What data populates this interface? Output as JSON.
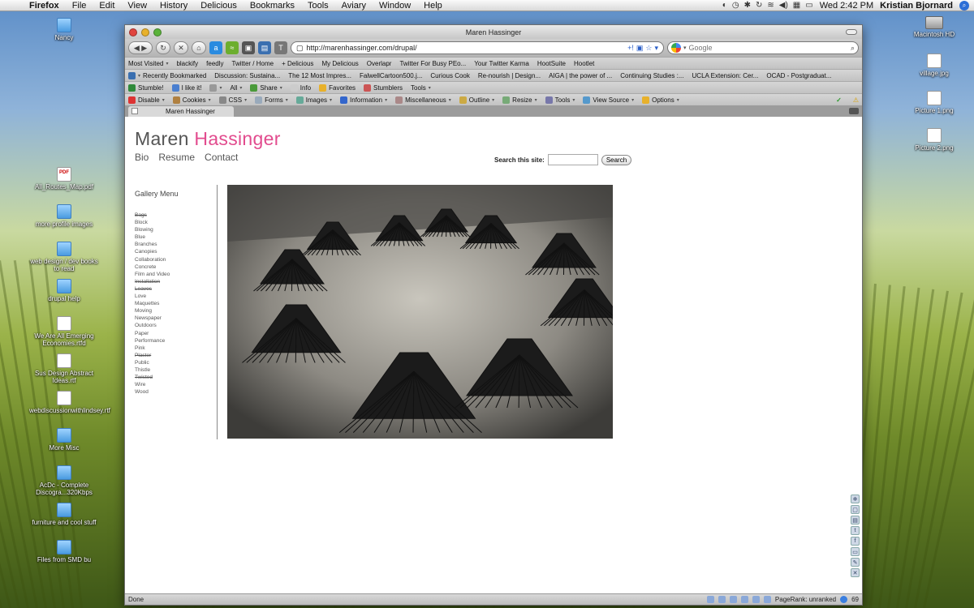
{
  "menubar": {
    "app": "Firefox",
    "items": [
      "File",
      "Edit",
      "View",
      "History",
      "Delicious",
      "Bookmarks",
      "Tools",
      "Aviary",
      "Window",
      "Help"
    ],
    "clock": "Wed 2:42 PM",
    "user": "Kristian Bjornard"
  },
  "desktop": {
    "icons": [
      "Nancy",
      "All_Routes_Map.pdf",
      "more profile images",
      "web design / dev books to read",
      "drupal help",
      "We Are All Emerging Economies.rtfd",
      "Sus Design Abstract Ideas.rtf",
      "webdiscussionwithlindsey.rtf",
      "More Misc",
      "AcDc - Complete Discogra...320Kbps",
      "furniture and cool stuff",
      "Files from SMD bu"
    ],
    "right_icons": [
      "Macintosh HD",
      "village.jpg",
      "Picture 1.png",
      "Picture 2.png"
    ]
  },
  "browser": {
    "window_title": "Maren Hassinger",
    "url": "http://marenhassinger.com/drupal/",
    "search_placeholder": "Google",
    "bookmarks": [
      "Most Visited",
      "blackify",
      "feedly",
      "Twitter / Home",
      "+ Delicious",
      "My Delicious",
      "Overlapr",
      "Twitter For Busy PEo...",
      "Your Twitter Karma",
      "HootSuite",
      "Hootlet"
    ],
    "bookmarks2": [
      "Recently Bookmarked",
      "Discussion: Sustaina...",
      "The 12 Most Impres...",
      "FalwellCartoon500.j...",
      "Curious Cook",
      "Re-nourish | Design...",
      "AIGA | the power of ...",
      "Continuing Studies :...",
      "UCLA Extension: Cer...",
      "OCAD - Postgraduat..."
    ],
    "stumble": [
      "Stumble!",
      "I like it!",
      "All",
      "Share",
      "Info",
      "Favorites",
      "Stumblers",
      "Tools"
    ],
    "devbar": [
      "Disable",
      "Cookies",
      "CSS",
      "Forms",
      "Images",
      "Information",
      "Miscellaneous",
      "Outline",
      "Resize",
      "Tools",
      "View Source",
      "Options"
    ],
    "tab_title": "Maren Hassinger",
    "status": "Done",
    "pagerank": "PageRank: unranked",
    "count": "69"
  },
  "site": {
    "title_first": "Maren",
    "title_last": "Hassinger",
    "nav": [
      "Bio",
      "Resume",
      "Contact"
    ],
    "search_label": "Search this site:",
    "search_button": "Search",
    "gallery_title": "Gallery Menu",
    "gallery_items": [
      "Bags",
      "Block",
      "Blowing",
      "Blue",
      "Branches",
      "Canopies",
      "Collaboration",
      "Concrete",
      "Film and Video",
      "Installation",
      "Leaves",
      "Love",
      "Maquettes",
      "Moving",
      "Newspaper",
      "Outdoors",
      "Paper",
      "Performance",
      "Pink",
      "Plaster",
      "Public",
      "Thistle",
      "Twisted",
      "Wire",
      "Wood"
    ],
    "struck_items": [
      "Bags",
      "Installation",
      "Leaves",
      "Plaster",
      "Twisted"
    ]
  },
  "colors": {
    "accent_pink": "#e24b8e",
    "title_gray": "#555555"
  }
}
